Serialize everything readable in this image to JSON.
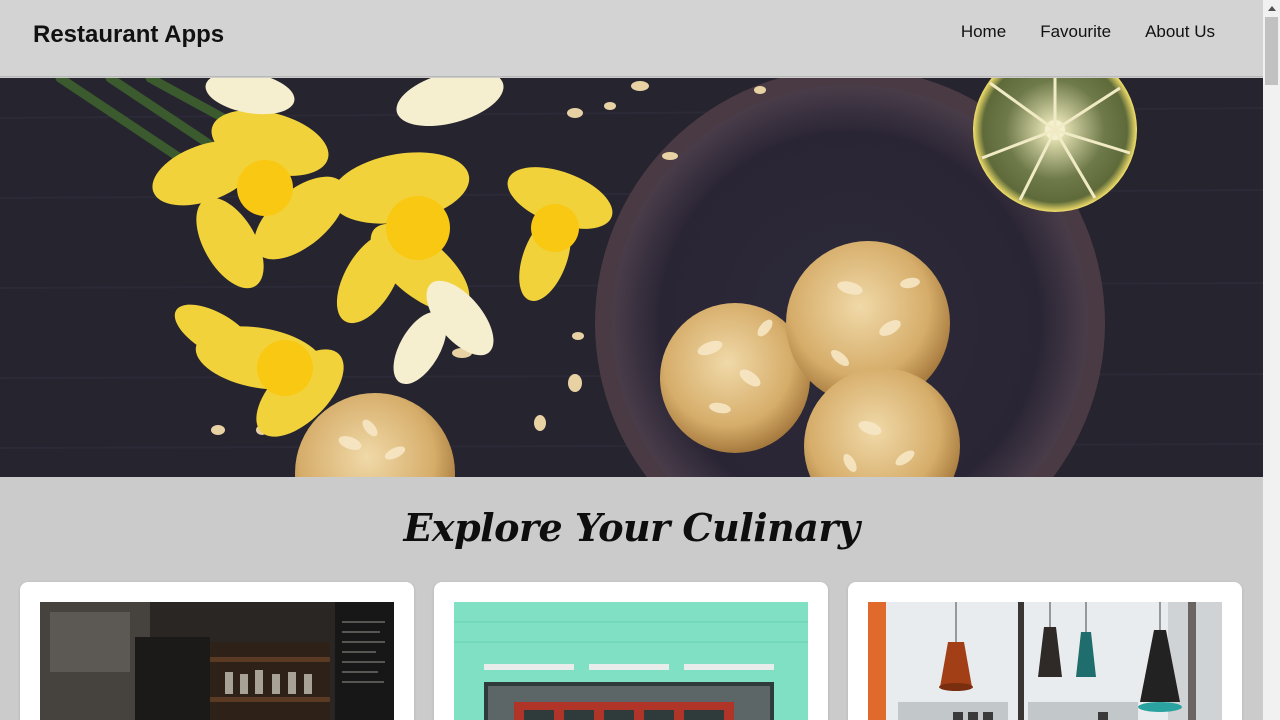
{
  "header": {
    "brand": "Restaurant Apps",
    "nav": [
      {
        "label": "Home"
      },
      {
        "label": "Favourite"
      },
      {
        "label": "About Us"
      }
    ]
  },
  "hero": {
    "image": "daffodils-and-almond-cookies-photo"
  },
  "section": {
    "title": "Explore Your Culinary"
  },
  "cards": [
    {
      "image": "restaurant-bar-interior-photo"
    },
    {
      "image": "mint-green-storefront-photo"
    },
    {
      "image": "pendant-lamps-cafe-photo"
    }
  ],
  "colors": {
    "header_bg": "#d3d3d3",
    "page_bg": "#cbcbcb",
    "card_bg": "#ffffff",
    "text": "#111111"
  }
}
